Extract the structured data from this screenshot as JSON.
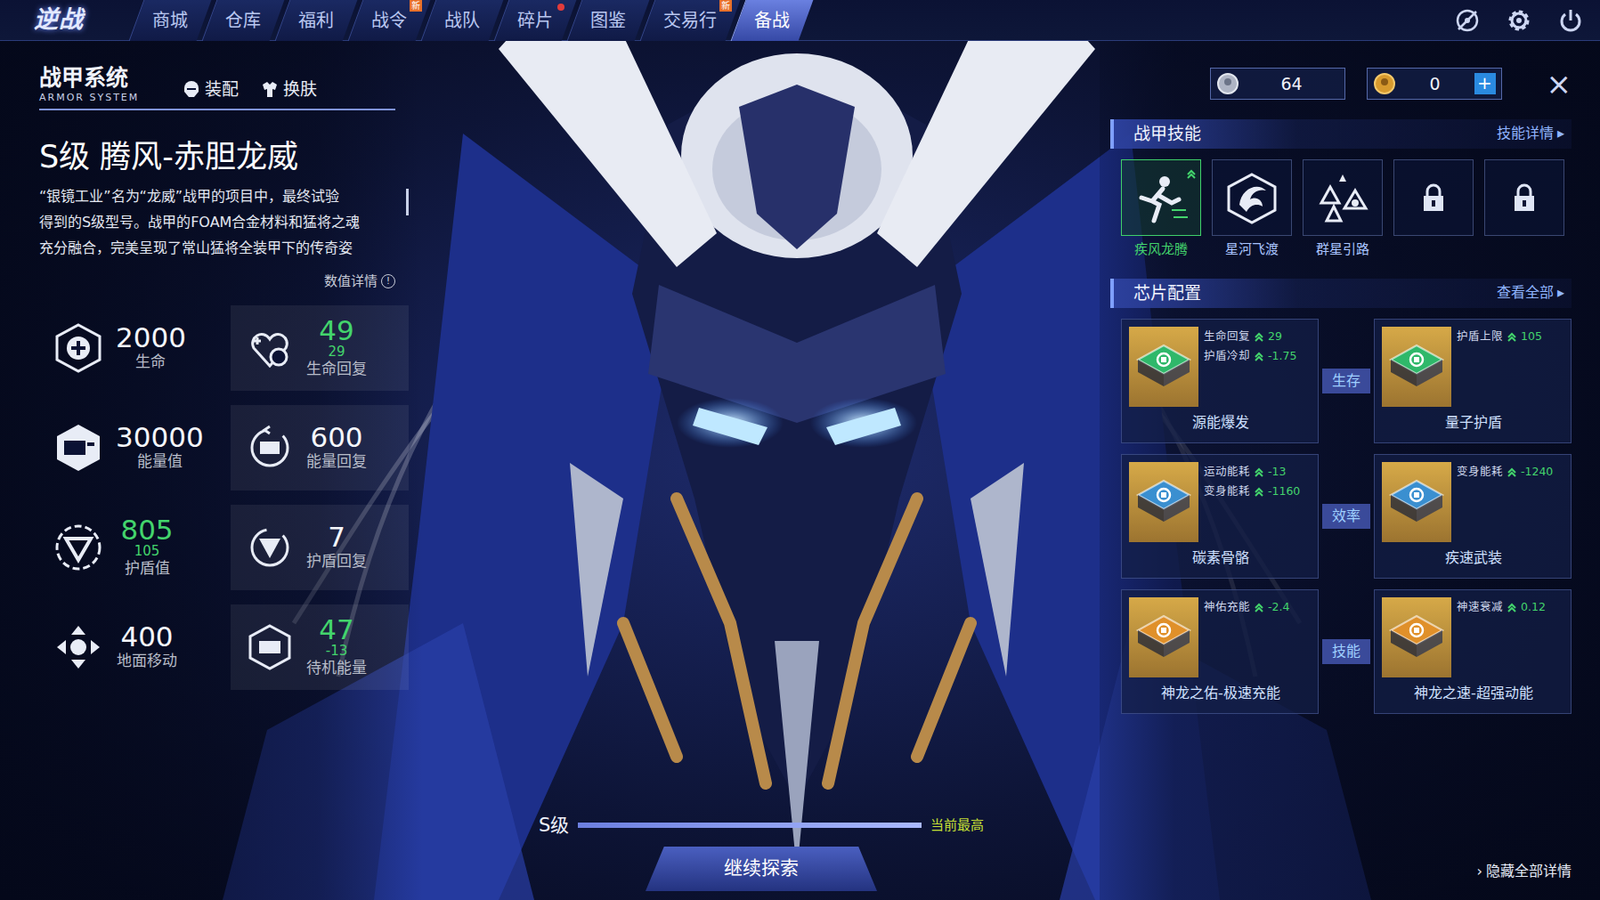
{
  "topbar": {
    "logo": "逆战",
    "tabs": [
      {
        "label": "商城",
        "selected": false,
        "dot": false
      },
      {
        "label": "仓库",
        "selected": false,
        "dot": false
      },
      {
        "label": "福利",
        "selected": false,
        "dot": false
      },
      {
        "label": "战令",
        "selected": false,
        "dot": false,
        "badge": "新"
      },
      {
        "label": "战队",
        "selected": false,
        "dot": false
      },
      {
        "label": "碎片",
        "selected": false,
        "dot": true
      },
      {
        "label": "图鉴",
        "selected": false,
        "dot": false
      },
      {
        "label": "交易行",
        "selected": false,
        "dot": false,
        "badge": "新"
      },
      {
        "label": "备战",
        "selected": true,
        "dot": false
      }
    ]
  },
  "system": {
    "title": "战甲系统",
    "subtitle": "ARMOR SYSTEM",
    "tabs": [
      {
        "label": "装配",
        "selected": false
      },
      {
        "label": "换肤",
        "selected": false
      }
    ]
  },
  "armor": {
    "name": "S级 腾风-赤胆龙威",
    "description": [
      "“银镜工业”名为“龙威”战甲的项目中，最终试验",
      "得到的S级型号。战甲的FOAM合金材料和猛将之魂",
      "充分融合，完美呈现了常山猛将全装甲下的传奇姿"
    ],
    "details": "数值详情",
    "details_icon": "!"
  },
  "stats": [
    {
      "value": "2000",
      "label": "生命",
      "highlight": false
    },
    {
      "value": "49",
      "sub": "29",
      "label": "生命回复",
      "highlight": true
    },
    {
      "value": "30000",
      "label": "能量值",
      "highlight": false
    },
    {
      "value": "600",
      "label": "能量回复",
      "highlight": false
    },
    {
      "value": "805",
      "sub": "105",
      "label": "护盾值",
      "highlight": true
    },
    {
      "value": "7",
      "label": "护盾回复",
      "highlight": false
    },
    {
      "value": "400",
      "label": "地面移动",
      "highlight": false
    },
    {
      "value": "47",
      "sub": "-13",
      "label": "待机能量",
      "highlight": true
    }
  ],
  "wallet": {
    "items": [
      {
        "value": "64"
      },
      {
        "value": "0",
        "add": "+"
      }
    ],
    "close": "×"
  },
  "skills": {
    "title": "战甲技能",
    "link": "技能详情",
    "arrow": "▸",
    "items": [
      {
        "label": "疾风龙腾",
        "selected": true,
        "locked": false,
        "upgradable": true
      },
      {
        "label": "星河飞渡",
        "selected": false,
        "locked": false,
        "upgradable": false
      },
      {
        "label": "群星引路",
        "selected": false,
        "locked": false,
        "upgradable": false
      },
      {
        "selected": false,
        "locked": true,
        "upgradable": false
      },
      {
        "selected": false,
        "locked": true,
        "upgradable": false
      }
    ]
  },
  "chips": {
    "title": "芯片配置",
    "link": "查看全部",
    "arrow": "▸",
    "rows": [
      {
        "category": "生存",
        "items": [
          {
            "name": "源能爆发",
            "color": "#2fb86a",
            "effects": [
              {
                "label": "生命回复",
                "value": "29"
              },
              {
                "label": "护盾冷却",
                "value": "-1.75"
              }
            ]
          },
          {
            "name": "量子护盾",
            "color": "#2fb86a",
            "effects": [
              {
                "label": "护盾上限",
                "value": "105"
              }
            ]
          }
        ]
      },
      {
        "category": "效率",
        "items": [
          {
            "name": "碳素骨骼",
            "color": "#3a8fd0",
            "effects": [
              {
                "label": "运动能耗",
                "value": "-13"
              },
              {
                "label": "变身能耗",
                "value": "-1160"
              }
            ]
          },
          {
            "name": "疾速武装",
            "color": "#3a8fd0",
            "effects": [
              {
                "label": "变身能耗",
                "value": "-1240"
              }
            ]
          }
        ]
      },
      {
        "category": "技能",
        "items": [
          {
            "name": "神龙之佑-极速充能",
            "color": "#e0902a",
            "effects": [
              {
                "label": "神佑充能",
                "value": "-2.4"
              }
            ]
          },
          {
            "name": "神龙之速-超强动能",
            "color": "#e0902a",
            "effects": [
              {
                "label": "神速衰减",
                "value": "0.12"
              }
            ]
          }
        ]
      }
    ]
  },
  "exploration": {
    "grade": "S级",
    "note": "当前最高",
    "level": 1,
    "button": "继续探索"
  },
  "hide_details": {
    "arrow": "›",
    "label": "隐藏全部详情"
  }
}
